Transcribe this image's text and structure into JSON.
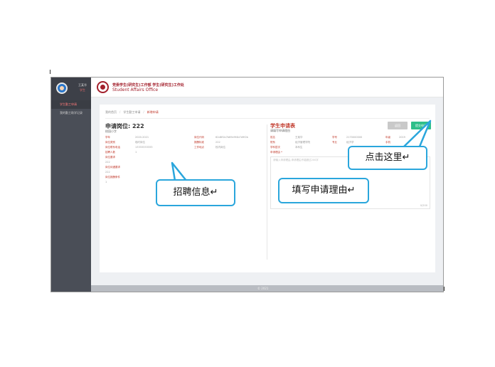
{
  "sidebar": {
    "user_name": "王某华",
    "user_role": "学生",
    "items": [
      {
        "label": "学生勤工申请"
      },
      {
        "label": "我的勤工助学记录"
      }
    ]
  },
  "header": {
    "org_cn": "党委学生(研究生)工作部 学生(研究生)工作处",
    "org_en": "Student Affairs Office"
  },
  "breadcrumb": {
    "home": "我的首页",
    "parent": "学生勤工申请",
    "current": "新增申请"
  },
  "position": {
    "title": "申请岗位: 222",
    "subtitle": "校园小字",
    "fields": [
      {
        "label": "学年",
        "value": "2020-2021"
      },
      {
        "label": "岗位类别",
        "value": "临时岗位"
      },
      {
        "label": "岗位联系电话",
        "value": "13333333333"
      },
      {
        "label": "招聘人数",
        "value": "1"
      },
      {
        "label": "岗位要求",
        "value": ""
      },
      {
        "label": "",
        "value": "222"
      },
      {
        "label": "岗位待遇要求",
        "value": ""
      },
      {
        "label": "",
        "value": "222"
      },
      {
        "label": "岗位报酬条件",
        "value": ""
      },
      {
        "label": "",
        "value": "1"
      }
    ],
    "fields_right": [
      {
        "label": "岗位代码",
        "value": "62d8f1b7b69e9f4b7d9f2b"
      },
      {
        "label": "报酬标准",
        "value": "222"
      },
      {
        "label": "工作地点",
        "value": "校内岗位"
      }
    ]
  },
  "application": {
    "title": "学生申请表",
    "subtitle": "请填写申请理由",
    "fields": [
      {
        "label": "姓名",
        "value": "王某华"
      },
      {
        "label": "学号",
        "value": "2170000000"
      },
      {
        "label": "年级",
        "value": "2019"
      },
      {
        "label": "院系",
        "value": "经济管理学院"
      },
      {
        "label": "专业",
        "value": "经济学"
      },
      {
        "label": "手机",
        "value": ""
      },
      {
        "label": "学科层次",
        "value": "本科生"
      },
      {
        "label": "申请理由 *",
        "value": ""
      }
    ],
    "textarea_placeholder": "请输入申请理由,申请理由不能超过200字",
    "counter": "0/200"
  },
  "buttons": {
    "back": "返回",
    "submit": "提交申请"
  },
  "footer": {
    "text": "© 2021"
  },
  "callouts": {
    "recruit_info": "招聘信息↵",
    "fill_reason": "填写申请理由↵",
    "click_here": "点击这里↵"
  }
}
